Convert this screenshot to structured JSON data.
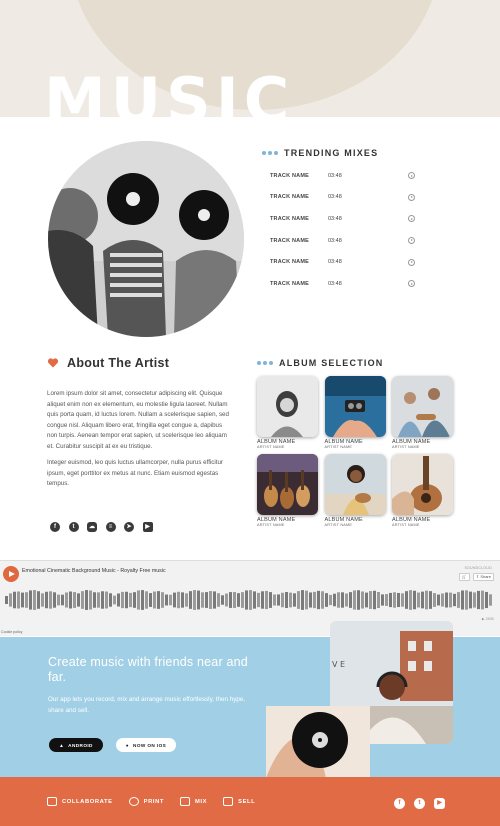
{
  "hero": {
    "title": "MUSIC"
  },
  "trending": {
    "heading": "TRENDING MIXES",
    "tracks": [
      {
        "name": "TRACK NAME",
        "duration": "03:48"
      },
      {
        "name": "TRACK NAME",
        "duration": "03:48"
      },
      {
        "name": "TRACK NAME",
        "duration": "03:48"
      },
      {
        "name": "TRACK NAME",
        "duration": "03:48"
      },
      {
        "name": "TRACK NAME",
        "duration": "03:48"
      },
      {
        "name": "TRACK NAME",
        "duration": "03:48"
      }
    ]
  },
  "about": {
    "heading": "About The Artist",
    "paragraphs": [
      "Lorem ipsum dolor sit amet, consectetur adipiscing elit. Quisque aliquet enim non ex elementum, eu molestie ligula laoreet. Nullam quis porta quam, id luctus lorem. Nullam a scelerisque sapien, sed congue nisl. Aliquam libero erat, fringilla eget congue a, dapibus non turpis. Aenean tempor erat sapien, ut scelerisque leo aliquam et. Curabitur suscipit at ex eu tristique.",
      "Integer euismod, leo quis luctus ullamcorper, nulla purus efficitur ipsum, eget porttitor ex metus at nunc. Etiam euismod egestas tempus."
    ],
    "social_icons": [
      "facebook-icon",
      "twitter-icon",
      "soundcloud-icon",
      "spotify-icon",
      "compass-icon",
      "youtube-icon"
    ]
  },
  "albums": {
    "heading": "ALBUM SELECTION",
    "items": [
      {
        "name": "ALBUM NAME",
        "artist": "ARTIST NAME"
      },
      {
        "name": "ALBUM NAME",
        "artist": "ARTIST NAME"
      },
      {
        "name": "ALBUM NAME",
        "artist": "ARTIST NAME"
      },
      {
        "name": "ALBUM NAME",
        "artist": "ARTIST NAME"
      },
      {
        "name": "ALBUM NAME",
        "artist": "ARTIST NAME"
      },
      {
        "name": "ALBUM NAME",
        "artist": "ARTIST NAME"
      }
    ]
  },
  "player": {
    "title": "Emotional Cinematic Background Music - Royalty Free music",
    "brand": "SOUNDCLOUD",
    "share_label": "Share",
    "plays": "283K",
    "cookie_label": "Cookie policy"
  },
  "cta": {
    "heading": "Create music with friends near and far.",
    "body": "Our app lets you record, mix and arrange music effortlessly, then hype, share and sell.",
    "android_label": "ANDROID",
    "ios_label": "NOW ON IOS"
  },
  "footer": {
    "links": [
      "COLLABORATE",
      "PRINT",
      "MIX",
      "SELL"
    ]
  },
  "colors": {
    "accent_orange": "#e06b45",
    "cta_blue": "#a1cfe6",
    "hero_bg": "#efebe4",
    "dot_blue": "#7fb6d8"
  }
}
